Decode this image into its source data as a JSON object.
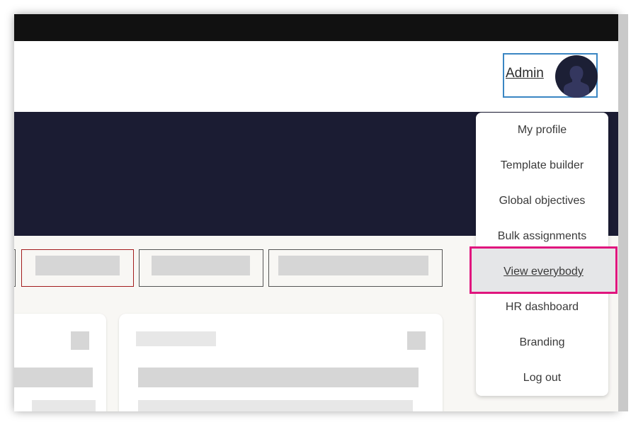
{
  "header": {
    "user_name": "Admin"
  },
  "user_menu": {
    "items": [
      {
        "label": "My profile"
      },
      {
        "label": "Template builder"
      },
      {
        "label": "Global objectives"
      },
      {
        "label": "Bulk assignments"
      },
      {
        "label": "View everybody"
      },
      {
        "label": "HR dashboard"
      },
      {
        "label": "Branding"
      },
      {
        "label": "Log out"
      }
    ],
    "highlighted": "View everybody"
  },
  "colors": {
    "banner": "#1b1c33",
    "highlight_border": "#e0157e",
    "focus_border": "#3a86c3",
    "active_tab_border": "#a31d1d"
  },
  "icons": {
    "avatar": "person-silhouette-icon"
  }
}
